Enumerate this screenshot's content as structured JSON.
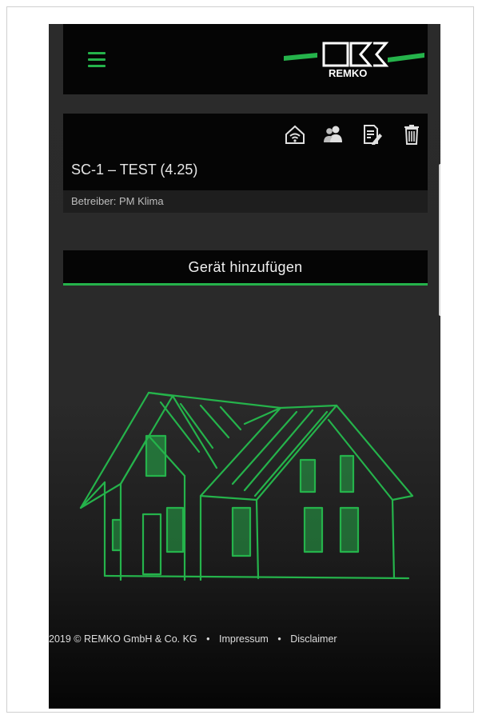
{
  "header": {
    "logo_text": "REMKO"
  },
  "card": {
    "title": "SC-1 – TEST (4.25)",
    "subtitle": "Betreiber: PM Klima",
    "icons": [
      "wifi-home-icon",
      "users-icon",
      "edit-document-icon",
      "trash-icon"
    ]
  },
  "actions": {
    "add_device_label": "Gerät hinzufügen"
  },
  "footer": {
    "copyright": "2019 © REMKO GmbH & Co. KG",
    "separator": "•",
    "impressum": "Impressum",
    "disclaimer": "Disclaimer"
  },
  "colors": {
    "accent": "#25b34b",
    "background": "#2a2a2a",
    "panel": "#050505"
  }
}
